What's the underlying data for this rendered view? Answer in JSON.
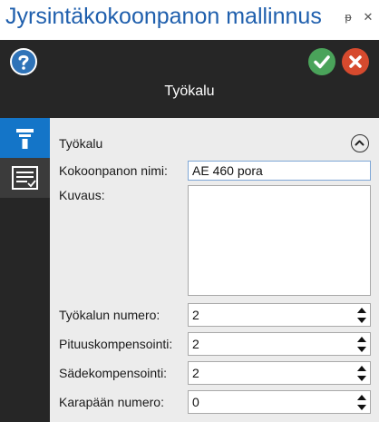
{
  "window": {
    "title": "Jyrsintäkokoonpanon mallinnus",
    "pin_glyph": "ᵽ",
    "close_glyph": "✕"
  },
  "header": {
    "label": "Työkalu"
  },
  "sidebar": {
    "tabs": [
      {
        "icon": "tool-icon",
        "active": true
      },
      {
        "icon": "list-settings-icon",
        "active": false
      }
    ]
  },
  "section": {
    "title": "Työkalu"
  },
  "form": {
    "name_label": "Kokoonpanon nimi:",
    "name_value": "AE 460 pora",
    "description_label": "Kuvaus:",
    "description_value": "",
    "tool_number_label": "Työkalun numero:",
    "tool_number_value": "2",
    "length_comp_label": "Pituuskompensointi:",
    "length_comp_value": "2",
    "radius_comp_label": "Sädekompensointi:",
    "radius_comp_value": "2",
    "spindle_label": "Karapään numero:",
    "spindle_value": "0"
  },
  "colors": {
    "title_blue": "#1f5fad",
    "header_dark": "#262626",
    "active_tab_blue": "#1475c8",
    "ok_green": "#4aa35a",
    "cancel_red": "#d64a2e",
    "panel_gray": "#ececec"
  }
}
